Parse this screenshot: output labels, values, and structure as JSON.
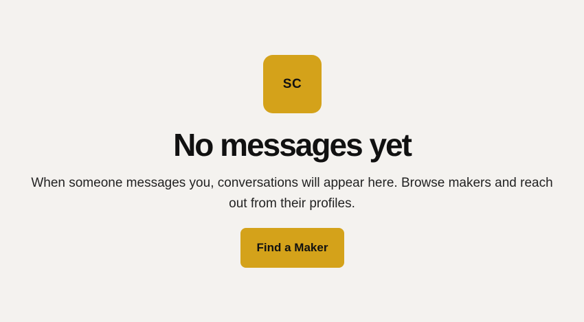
{
  "empty_state": {
    "avatar_initials": "SC",
    "title": "No messages yet",
    "description": "When someone messages you, conversations will appear here. Browse makers and reach out from their profiles.",
    "cta_label": "Find a Maker"
  },
  "colors": {
    "background": "#f4f2ef",
    "accent": "#d4a21a",
    "text": "#111111"
  }
}
